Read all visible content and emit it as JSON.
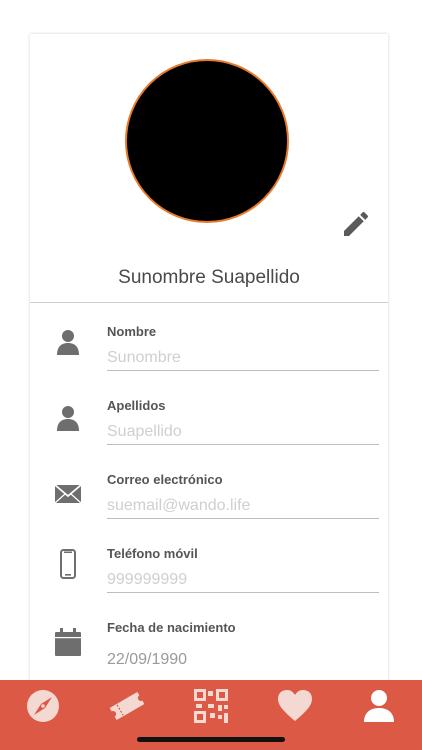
{
  "profile": {
    "full_name": "Sunombre Suapellido"
  },
  "fields": [
    {
      "label": "Nombre",
      "placeholder": "Sunombre",
      "icon": "user-icon"
    },
    {
      "label": "Apellidos",
      "placeholder": "Suapellido",
      "icon": "user-icon"
    },
    {
      "label": "Correo electrónico",
      "placeholder": "suemail@wando.life",
      "icon": "envelope-icon"
    },
    {
      "label": "Teléfono móvil",
      "placeholder": "999999999",
      "icon": "phone-icon"
    },
    {
      "label": "Fecha de nacimiento",
      "value": "22/09/1990",
      "icon": "calendar-icon"
    }
  ],
  "tabbar": {
    "items": [
      "explore-icon",
      "tickets-icon",
      "qr-code-icon",
      "favorites-icon",
      "profile-icon"
    ],
    "active": "profile-icon"
  },
  "colors": {
    "accent": "#dc5a45",
    "avatar_border": "#e87a2a"
  }
}
